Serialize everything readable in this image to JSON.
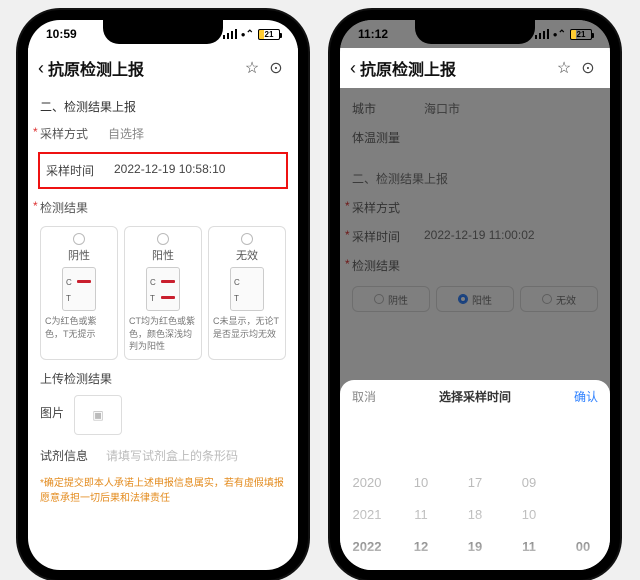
{
  "left": {
    "status": {
      "time": "10:59",
      "battery": "21"
    },
    "nav": {
      "title": "抗原检测上报"
    },
    "section2": "二、检测结果上报",
    "sample_method": {
      "label": "采样方式",
      "value": "自选择"
    },
    "sample_time": {
      "label": "采样时间",
      "value": "2022-12-19 10:58:10"
    },
    "result_label": "检测结果",
    "options": [
      {
        "name": "阴性",
        "desc": "C为红色或紫色，T无提示"
      },
      {
        "name": "阳性",
        "desc": "CT均为红色或紫色，颜色深浅均判为阳性"
      },
      {
        "name": "无效",
        "desc": "C未显示，无论T是否显示均无效"
      }
    ],
    "upload": {
      "label": "上传检测结果",
      "hint": "图片"
    },
    "kit": {
      "label": "试剂信息",
      "placeholder": "请填写试剂盒上的条形码"
    },
    "disclaimer": "*确定提交即本人承诺上述申报信息属实，若有虚假填报愿意承担一切后果和法律责任"
  },
  "right": {
    "status": {
      "time": "11:12",
      "battery": "21"
    },
    "nav": {
      "title": "抗原检测上报"
    },
    "city": {
      "label": "城市",
      "value": "海口市"
    },
    "temp": {
      "label": "体温测量",
      "value": ""
    },
    "section2": "二、检测结果上报",
    "sample_method": {
      "label": "采样方式",
      "value": ""
    },
    "sample_time": {
      "label": "采样时间",
      "value": "2022-12-19 11:00:02"
    },
    "result_label": "检测结果",
    "options": [
      "阴性",
      "阳性",
      "无效"
    ],
    "selected_index": 1,
    "sheet": {
      "cancel": "取消",
      "title": "选择采样时间",
      "ok": "确认",
      "cols": [
        [
          "2020",
          "2021",
          "2022"
        ],
        [
          "10",
          "11",
          "12"
        ],
        [
          "17",
          "18",
          "19"
        ],
        [
          "09",
          "10",
          "11"
        ],
        [
          "",
          "",
          "00"
        ]
      ],
      "selected_row": 2
    }
  }
}
